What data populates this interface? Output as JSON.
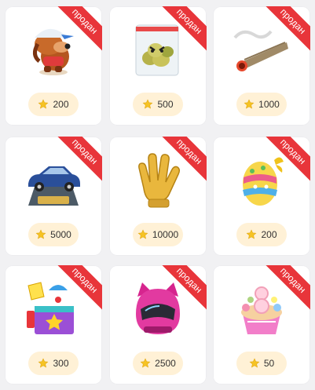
{
  "status_label": "продан",
  "accent": "#e8353a",
  "price_bg": "#fff1d6",
  "items": [
    {
      "name": "dog-in-cap-gift",
      "price": "200"
    },
    {
      "name": "bag-of-buds-gift",
      "price": "500"
    },
    {
      "name": "joint-gift",
      "price": "1000"
    },
    {
      "name": "blue-car-trophy-gift",
      "price": "5000"
    },
    {
      "name": "golden-glove-gift",
      "price": "10000"
    },
    {
      "name": "easter-egg-gift",
      "price": "200"
    },
    {
      "name": "jack-in-the-box-gift",
      "price": "300"
    },
    {
      "name": "pink-cat-helmet-gift",
      "price": "2500"
    },
    {
      "name": "flower-8-cake-gift",
      "price": "50"
    }
  ]
}
